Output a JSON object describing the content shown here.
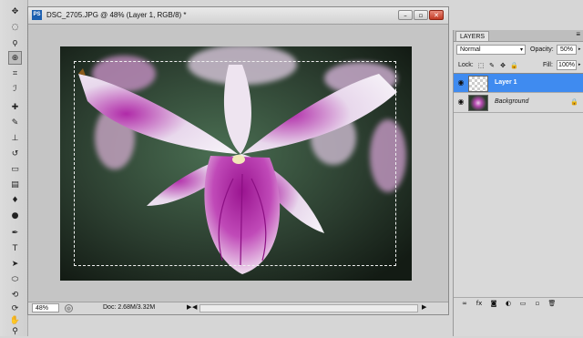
{
  "document": {
    "badge": "PS",
    "title": "DSC_2705.JPG @ 48% (Layer 1, RGB/8) *",
    "win_minimize": "–",
    "win_restore": "▫",
    "win_close": "✕"
  },
  "status": {
    "zoom": "48%",
    "zoom_icon": "◎",
    "doc_info": "Doc: 2.68M/3.32M",
    "arrow": "▶",
    "scroll_left": "◀",
    "scroll_right": "▶"
  },
  "tools": [
    {
      "name": "move-tool-icon",
      "glyph": "✥"
    },
    {
      "name": "marquee-tool-icon",
      "glyph": "◌"
    },
    {
      "name": "lasso-tool-icon",
      "glyph": "ϙ"
    },
    {
      "name": "zoom-tool-icon",
      "glyph": "⊕"
    },
    {
      "name": "crop-tool-icon",
      "glyph": "⌗"
    },
    {
      "name": "eyedropper-tool-icon",
      "glyph": "ℐ"
    },
    {
      "name": "healing-brush-tool-icon",
      "glyph": "✚"
    },
    {
      "name": "brush-tool-icon",
      "glyph": "✎"
    },
    {
      "name": "clone-stamp-tool-icon",
      "glyph": "⊥"
    },
    {
      "name": "history-brush-tool-icon",
      "glyph": "↺"
    },
    {
      "name": "eraser-tool-icon",
      "glyph": "▭"
    },
    {
      "name": "gradient-tool-icon",
      "glyph": "▤"
    },
    {
      "name": "blur-tool-icon",
      "glyph": "♦"
    },
    {
      "name": "dodge-tool-icon",
      "glyph": "●"
    },
    {
      "name": "pen-tool-icon",
      "glyph": "✒"
    },
    {
      "name": "type-tool-icon",
      "glyph": "T"
    },
    {
      "name": "path-selection-tool-icon",
      "glyph": "➤"
    },
    {
      "name": "shape-tool-icon",
      "glyph": "⬭"
    },
    {
      "name": "3d-rotate-tool-icon",
      "glyph": "⟲"
    },
    {
      "name": "3d-orbit-tool-icon",
      "glyph": "⟳"
    },
    {
      "name": "hand-tool-icon",
      "glyph": "✋"
    },
    {
      "name": "zoom-view-tool-icon",
      "glyph": "⚲"
    }
  ],
  "layers": {
    "tab": "LAYERS",
    "menu": "≡",
    "blend_mode": "Normal",
    "dropdown": "▾",
    "opacity_label": "Opacity:",
    "opacity_value": "50%",
    "lock_label": "Lock:",
    "lock_icons": [
      "⬚",
      "✎",
      "✥",
      "🔒"
    ],
    "fill_label": "Fill:",
    "fill_value": "100%",
    "arrow": "▸",
    "items": [
      {
        "name": "Layer 1",
        "visible_icon": "◉",
        "selected": true
      },
      {
        "name": "Background",
        "visible_icon": "◉",
        "locked_icon": "🔒"
      }
    ],
    "footer_icons": [
      "∞",
      "fx",
      "◙",
      "◐",
      "▭",
      "▫",
      "🗑"
    ]
  },
  "colors": {
    "selected_layer": "#3f8bf0",
    "workspace": "#c5c5c5"
  }
}
